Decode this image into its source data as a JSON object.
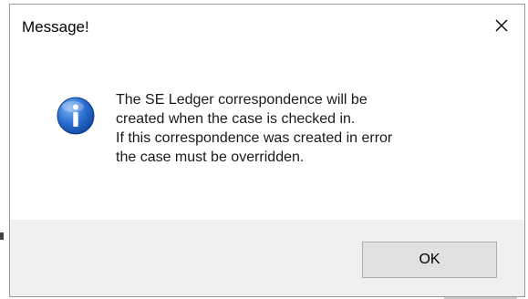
{
  "dialog": {
    "title": "Message!",
    "close_icon": "close-icon",
    "icon": "info-icon",
    "accent_color": "#2a6fd1",
    "message_lines": [
      "The SE Ledger correspondence will be",
      "created when the case is checked in.",
      "If this correspondence was created in error",
      "the case must be overridden."
    ],
    "ok_label": "OK"
  }
}
